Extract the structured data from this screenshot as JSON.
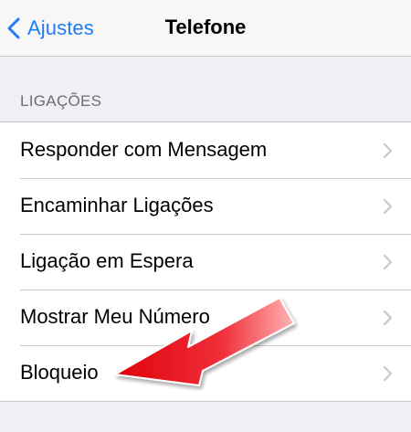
{
  "navbar": {
    "back_label": "Ajustes",
    "title": "Telefone"
  },
  "section": {
    "header": "LIGAÇÕES"
  },
  "rows": [
    {
      "label": "Responder com Mensagem"
    },
    {
      "label": "Encaminhar Ligações"
    },
    {
      "label": "Ligação em Espera"
    },
    {
      "label": "Mostrar Meu Número"
    },
    {
      "label": "Bloqueio"
    }
  ],
  "colors": {
    "accent": "#1f7cf6",
    "background": "#efeff4",
    "annotation_arrow": "#e8141b"
  },
  "icons": {
    "back": "chevron-left-icon",
    "disclosure": "chevron-right-icon",
    "annotation": "red-arrow-icon"
  }
}
